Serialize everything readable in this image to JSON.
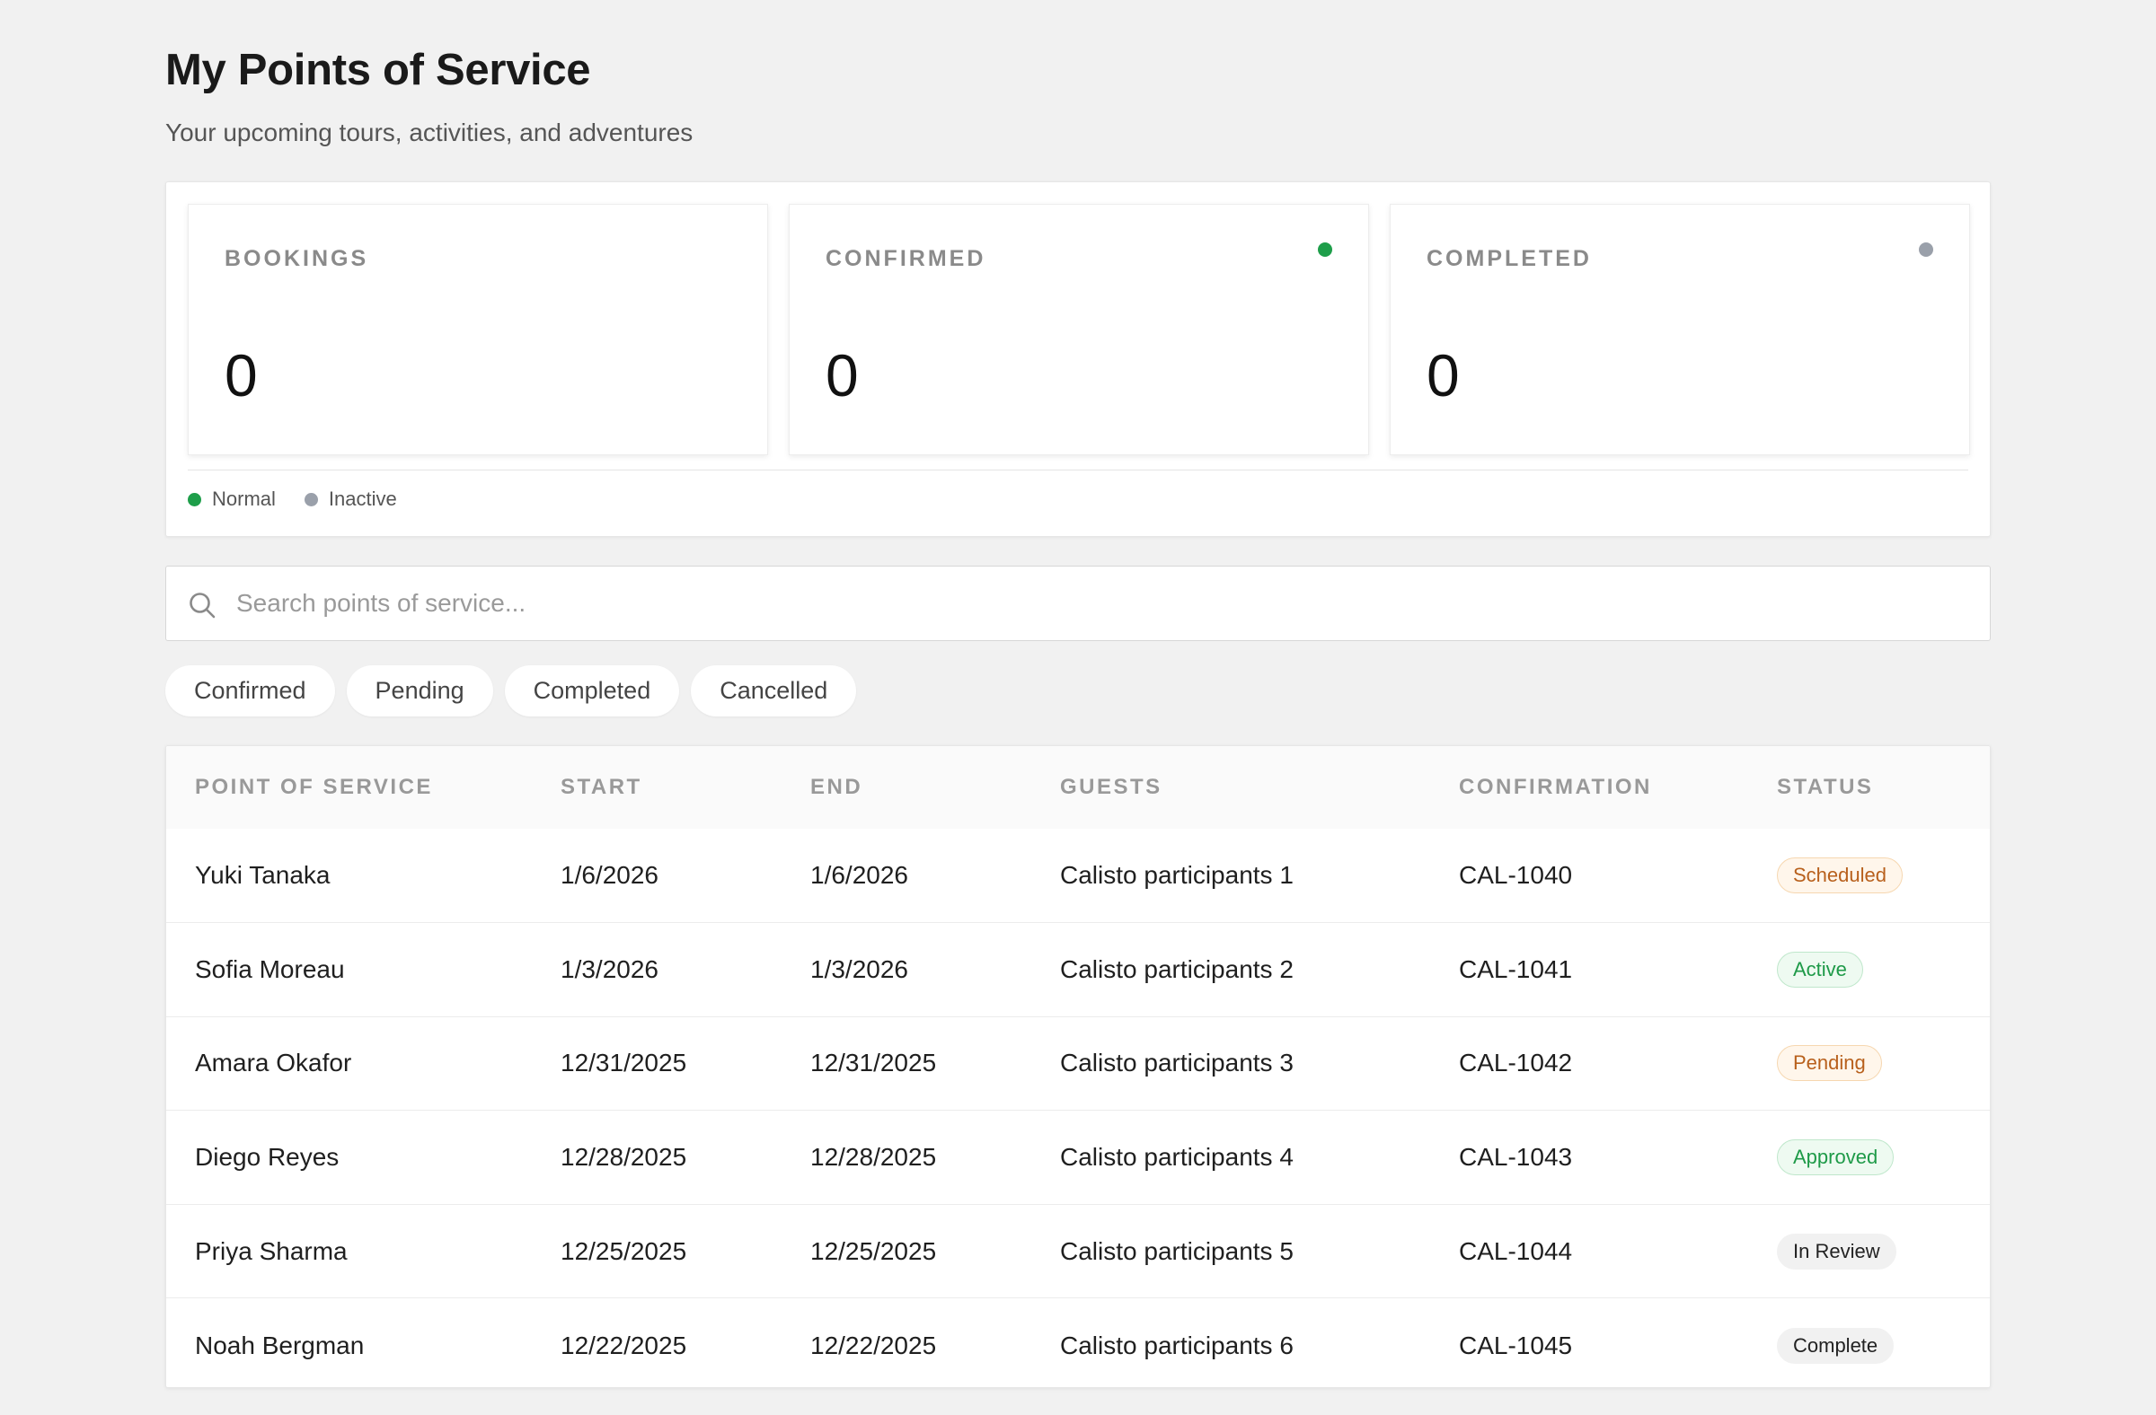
{
  "header": {
    "title": "My Points of Service",
    "subtitle": "Your upcoming tours, activities, and adventures"
  },
  "stats": {
    "cards": [
      {
        "label": "BOOKINGS",
        "value": "0",
        "dot_color": null
      },
      {
        "label": "CONFIRMED",
        "value": "0",
        "dot_color": "#1e9e4a"
      },
      {
        "label": "COMPLETED",
        "value": "0",
        "dot_color": "#9aa0aa"
      }
    ],
    "legend": [
      {
        "label": "Normal",
        "color": "#1e9e4a"
      },
      {
        "label": "Inactive",
        "color": "#9aa0aa"
      }
    ]
  },
  "search": {
    "placeholder": "Search points of service...",
    "value": ""
  },
  "filters": [
    "Confirmed",
    "Pending",
    "Completed",
    "Cancelled"
  ],
  "table": {
    "columns": [
      "POINT OF SERVICE",
      "START",
      "END",
      "GUESTS",
      "CONFIRMATION",
      "STATUS"
    ],
    "rows": [
      {
        "name": "Yuki Tanaka",
        "start": "1/6/2026",
        "end": "1/6/2026",
        "guests": "Calisto participants 1",
        "confirmation": "CAL-1040",
        "status": "Scheduled",
        "status_kind": "scheduled"
      },
      {
        "name": "Sofia Moreau",
        "start": "1/3/2026",
        "end": "1/3/2026",
        "guests": "Calisto participants 2",
        "confirmation": "CAL-1041",
        "status": "Active",
        "status_kind": "active"
      },
      {
        "name": "Amara Okafor",
        "start": "12/31/2025",
        "end": "12/31/2025",
        "guests": "Calisto participants 3",
        "confirmation": "CAL-1042",
        "status": "Pending",
        "status_kind": "pending"
      },
      {
        "name": "Diego Reyes",
        "start": "12/28/2025",
        "end": "12/28/2025",
        "guests": "Calisto participants 4",
        "confirmation": "CAL-1043",
        "status": "Approved",
        "status_kind": "approved"
      },
      {
        "name": "Priya Sharma",
        "start": "12/25/2025",
        "end": "12/25/2025",
        "guests": "Calisto participants 5",
        "confirmation": "CAL-1044",
        "status": "In Review",
        "status_kind": "review"
      },
      {
        "name": "Noah Bergman",
        "start": "12/22/2025",
        "end": "12/22/2025",
        "guests": "Calisto participants 6",
        "confirmation": "CAL-1045",
        "status": "Complete",
        "status_kind": "complete"
      }
    ]
  }
}
